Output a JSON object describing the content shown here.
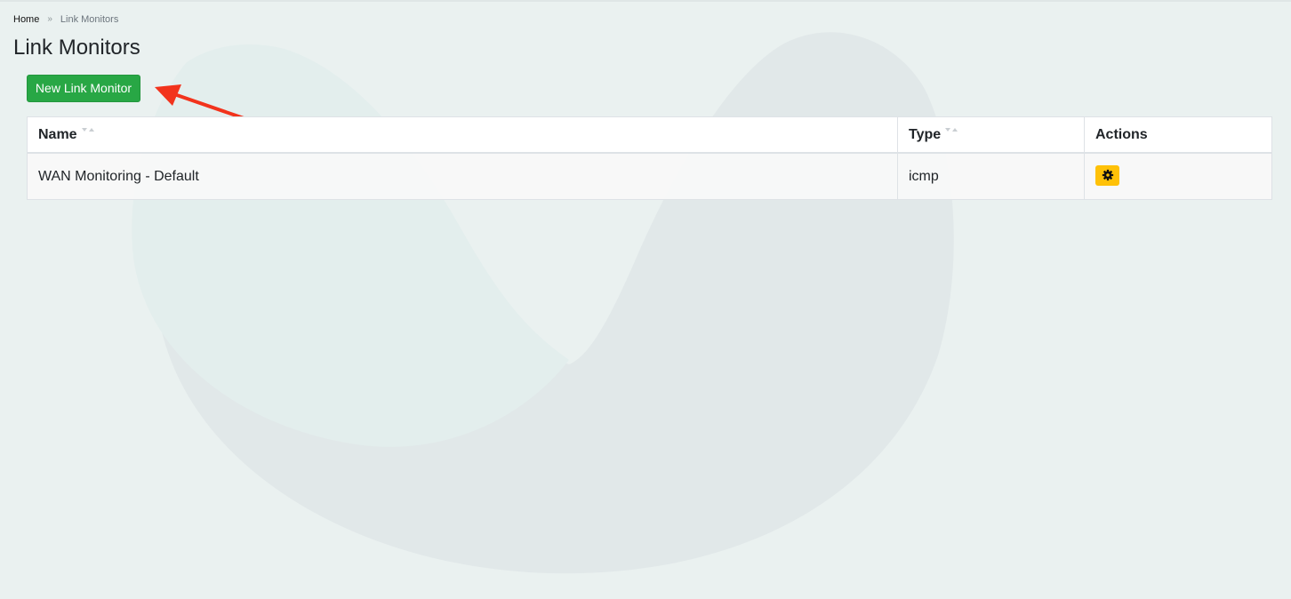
{
  "breadcrumb": {
    "home": "Home",
    "separator": "»",
    "current": "Link Monitors"
  },
  "page": {
    "title": "Link Monitors"
  },
  "toolbar": {
    "new_label": "New Link Monitor"
  },
  "table": {
    "columns": [
      {
        "label": "Name",
        "sortable": true
      },
      {
        "label": "Type",
        "sortable": true
      },
      {
        "label": "Actions",
        "sortable": false
      }
    ],
    "rows": [
      {
        "name": "WAN Monitoring - Default",
        "type": "icmp",
        "action_icon": "gear-icon"
      }
    ]
  },
  "colors": {
    "page_background": "#eaf1f0",
    "primary_button": "#28a745",
    "action_button": "#ffc107",
    "annotation_arrow": "#f2331c"
  }
}
